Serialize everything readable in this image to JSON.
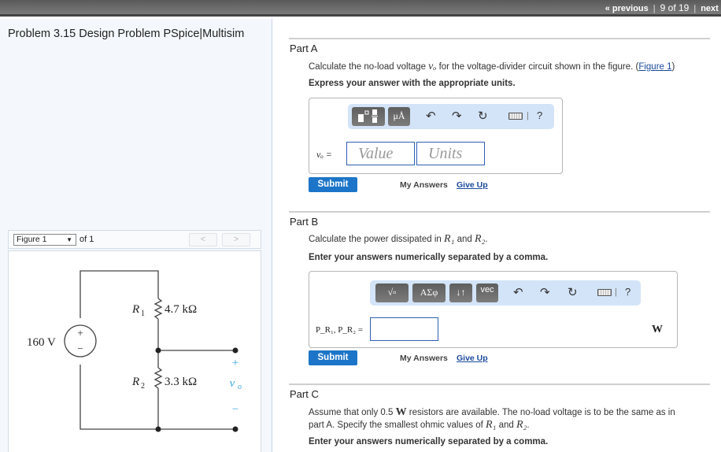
{
  "topnav": {
    "previous_label": "« previous",
    "position": "9 of 19",
    "next_label": "next »"
  },
  "problem": {
    "title": "Problem 3.15 Design Problem PSpice|Multisim"
  },
  "figure_panel": {
    "select_value": "Figure 1",
    "of_label": "of 1",
    "prev_glyph": "<",
    "next_glyph": ">",
    "circuit": {
      "source_label": "160 V",
      "source_plus": "+",
      "source_minus": "−",
      "r1_name": "R",
      "r1_sub": "1",
      "r1_value": "4.7 kΩ",
      "r2_name": "R",
      "r2_sub": "2",
      "r2_value": "3.3 kΩ",
      "out_plus": "+",
      "out_label": "v",
      "out_sub": "o",
      "out_minus": "−"
    }
  },
  "parts": {
    "a": {
      "title": "Part A",
      "question_pre": "Calculate the no-load voltage ",
      "question_var": "vₒ",
      "question_post": " for the voltage-divider circuit shown in the figure. (",
      "figure_link": "Figure 1",
      "question_close": ")",
      "instruction": "Express your answer with the appropriate units.",
      "toolbar": {
        "btn1": "templates",
        "btn2": "μÅ",
        "undo": "↶",
        "redo": "↷",
        "reset": "↻",
        "bar": "|",
        "help": "?"
      },
      "var_label": "vₒ =",
      "value_placeholder": "Value",
      "units_placeholder": "Units",
      "submit": "Submit",
      "my_answers": "My Answers",
      "give_up": "Give Up"
    },
    "b": {
      "title": "Part B",
      "question_pre": "Calculate the power dissipated in ",
      "r1": "R₁",
      "and": " and ",
      "r2": "R₂",
      "question_post": ".",
      "instruction": "Enter your answers numerically separated by a comma.",
      "toolbar": {
        "btn1": "√▫",
        "btn2": "ΑΣφ",
        "btn3": "↓↑",
        "btn4": "vec",
        "undo": "↶",
        "redo": "↷",
        "reset": "↻",
        "bar": "|",
        "help": "?"
      },
      "var_label": "P_R₁, P_R₂ =",
      "value": "",
      "unit": "W",
      "submit": "Submit",
      "my_answers": "My Answers",
      "give_up": "Give Up"
    },
    "c": {
      "title": "Part C",
      "line1_pre": "Assume that only 0.5 ",
      "line1_unit": "W",
      "line1_post": " resistors are available. The no-load voltage is to be the same as in",
      "line2_pre": "part A. Specify the smallest ohmic values of ",
      "r1": "R₁",
      "and": " and ",
      "r2": "R₂",
      "line2_post": ".",
      "instruction": "Enter your answers numerically separated by a comma."
    }
  }
}
